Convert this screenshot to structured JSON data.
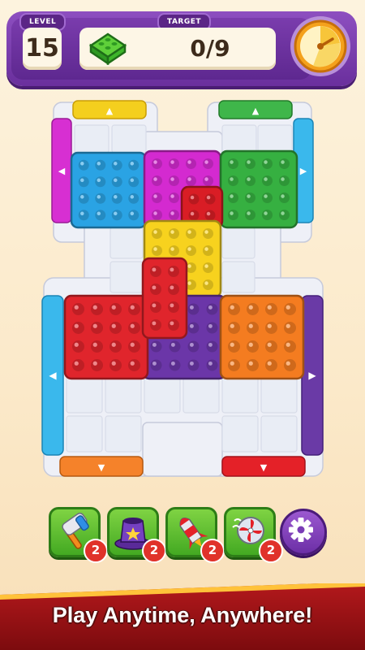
{
  "hud": {
    "level_label": "LEVEL",
    "level_value": "15",
    "target_label": "TARGET",
    "target_count": "0/9",
    "target_icon": "green-block-icon",
    "timer_icon": "clock-icon"
  },
  "board": {
    "pushers": [
      {
        "name": "yellow-pusher-top",
        "color": "#f4cf1e",
        "arrow": "▲"
      },
      {
        "name": "green-pusher-top",
        "color": "#3fb64a",
        "arrow": "▲"
      },
      {
        "name": "magenta-pusher-left",
        "color": "#d72fd2",
        "arrow": "◀"
      },
      {
        "name": "blue-pusher-right",
        "color": "#3ab8ec",
        "arrow": "▶"
      },
      {
        "name": "blue-pusher-left",
        "color": "#3ab8ec",
        "arrow": "◀"
      },
      {
        "name": "purple-pusher-right",
        "color": "#6a3aa6",
        "arrow": "▶"
      },
      {
        "name": "orange-pusher-bottom",
        "color": "#f5822a",
        "arrow": "▼"
      },
      {
        "name": "red-pusher-bottom",
        "color": "#e42128",
        "arrow": "▼"
      }
    ],
    "blocks": [
      {
        "name": "blue-block",
        "color": "#2aa3e4"
      },
      {
        "name": "magenta-block",
        "color": "#d42ad0"
      },
      {
        "name": "green-block",
        "color": "#36b041"
      },
      {
        "name": "red-small-block",
        "color": "#d91d25"
      },
      {
        "name": "yellow-block",
        "color": "#f7d21e"
      },
      {
        "name": "red-block",
        "color": "#e0252c"
      },
      {
        "name": "purple-block",
        "color": "#6b36a8"
      },
      {
        "name": "orange-block",
        "color": "#f47c20"
      }
    ]
  },
  "boosters": [
    {
      "name": "hammer-booster",
      "icon": "hammer-icon",
      "count": "2"
    },
    {
      "name": "magic-hat-booster",
      "icon": "magic-hat-icon",
      "count": "2"
    },
    {
      "name": "rocket-booster",
      "icon": "rocket-icon",
      "count": "2"
    },
    {
      "name": "fan-booster",
      "icon": "fan-icon",
      "count": "2"
    }
  ],
  "settings_icon": "gear-icon",
  "banner": {
    "text": "Play Anytime, Anywhere!"
  }
}
